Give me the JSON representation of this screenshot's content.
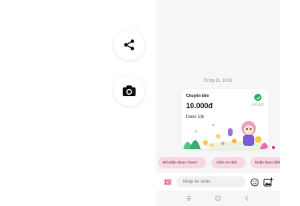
{
  "actions": {
    "share_icon": "share-icon",
    "camera_icon": "camera-icon"
  },
  "chat": {
    "timestamp": "15 thg 01, 16:52",
    "transfer_card": {
      "title": "Chuyển tiền",
      "amount": "10.000đ",
      "status": "Đã gửi",
      "note": "Diane 13k",
      "status_color": "#21b25e"
    },
    "quick_replies": [
      {
        "label": "Đã nhận được chưa?"
      },
      {
        "label": "Cảm ơn nhé"
      },
      {
        "label": "Nhận được tiền"
      }
    ]
  },
  "composer": {
    "placeholder": "Nhập tin nhắn",
    "tag_icon": "gift-tag-icon",
    "emoji_icon": "emoji-icon",
    "image_icon": "image-add-icon"
  },
  "colors": {
    "chip_bg": "#fbd6e4",
    "accent": "#d63a9a",
    "success": "#21b25e"
  },
  "navbar": {
    "items": [
      "menu-icon",
      "home-icon",
      "back-icon"
    ]
  }
}
